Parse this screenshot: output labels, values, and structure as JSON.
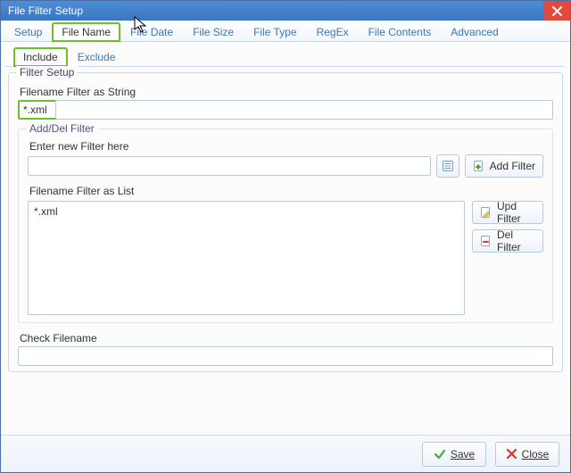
{
  "window": {
    "title": "File Filter Setup"
  },
  "tabs": {
    "top": [
      {
        "label": "Setup"
      },
      {
        "label": "File Name"
      },
      {
        "label": "File Date"
      },
      {
        "label": "File Size"
      },
      {
        "label": "File Type"
      },
      {
        "label": "RegEx"
      },
      {
        "label": "File Contents"
      },
      {
        "label": "Advanced"
      }
    ],
    "sub": [
      {
        "label": "Include"
      },
      {
        "label": "Exclude"
      }
    ]
  },
  "filter_setup": {
    "legend": "Filter Setup",
    "string_label": "Filename Filter as String",
    "string_value": "*.xml",
    "adddel": {
      "legend": "Add/Del Filter",
      "enter_label": "Enter new Filter here",
      "enter_value": "",
      "add_button": "Add Filter"
    },
    "list_label": "Filename Filter as List",
    "list_items": [
      "*.xml"
    ],
    "upd_button": "Upd Filter",
    "del_button": "Del Filter",
    "check_label": "Check Filename",
    "check_value": ""
  },
  "footer": {
    "save": "Save",
    "close": "Close"
  },
  "icons": {
    "close_x": "close-icon",
    "browse": "browse-icon",
    "add": "plus-icon",
    "upd": "document-edit-icon",
    "del": "document-delete-icon",
    "check_ok": "checkmark-icon",
    "cancel_x": "cancel-icon"
  }
}
